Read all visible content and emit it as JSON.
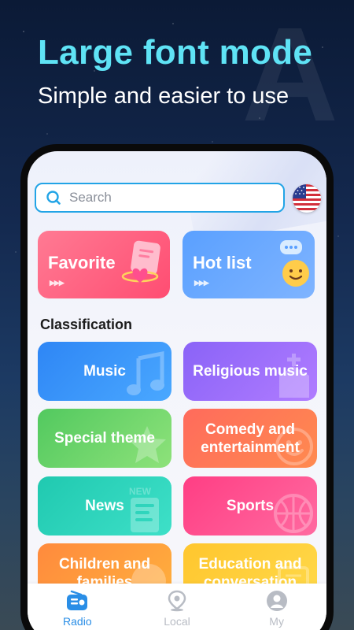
{
  "promo": {
    "headline": "Large font mode",
    "subline": "Simple and easier to use"
  },
  "search": {
    "placeholder": "Search"
  },
  "region_flag": "us-flag-icon",
  "featured": [
    {
      "label": "Favorite",
      "icon": "notebook-heart-icon"
    },
    {
      "label": "Hot list",
      "icon": "smiley-chat-icon"
    }
  ],
  "classification": {
    "title": "Classification",
    "categories": [
      {
        "label": "Music",
        "icon": "music-note-icon"
      },
      {
        "label": "Religious music",
        "icon": "church-icon"
      },
      {
        "label": "Special theme",
        "icon": "star-icon"
      },
      {
        "label": "Comedy and entertainment",
        "icon": "smile-icon"
      },
      {
        "label": "News",
        "icon": "newspaper-icon"
      },
      {
        "label": "Sports",
        "icon": "basketball-icon"
      },
      {
        "label": "Children and families",
        "icon": "child-icon"
      },
      {
        "label": "Education and conversation",
        "icon": "book-icon"
      }
    ]
  },
  "tabs": [
    {
      "label": "Radio",
      "icon": "radio-icon",
      "active": true
    },
    {
      "label": "Local",
      "icon": "location-pin-icon",
      "active": false
    },
    {
      "label": "My",
      "icon": "user-icon",
      "active": false
    }
  ],
  "colors": {
    "headline": "#5fe3f5",
    "search_border": "#22a4e6",
    "tab_active": "#2a8ee6",
    "tab_inactive": "#b8bcc4"
  }
}
